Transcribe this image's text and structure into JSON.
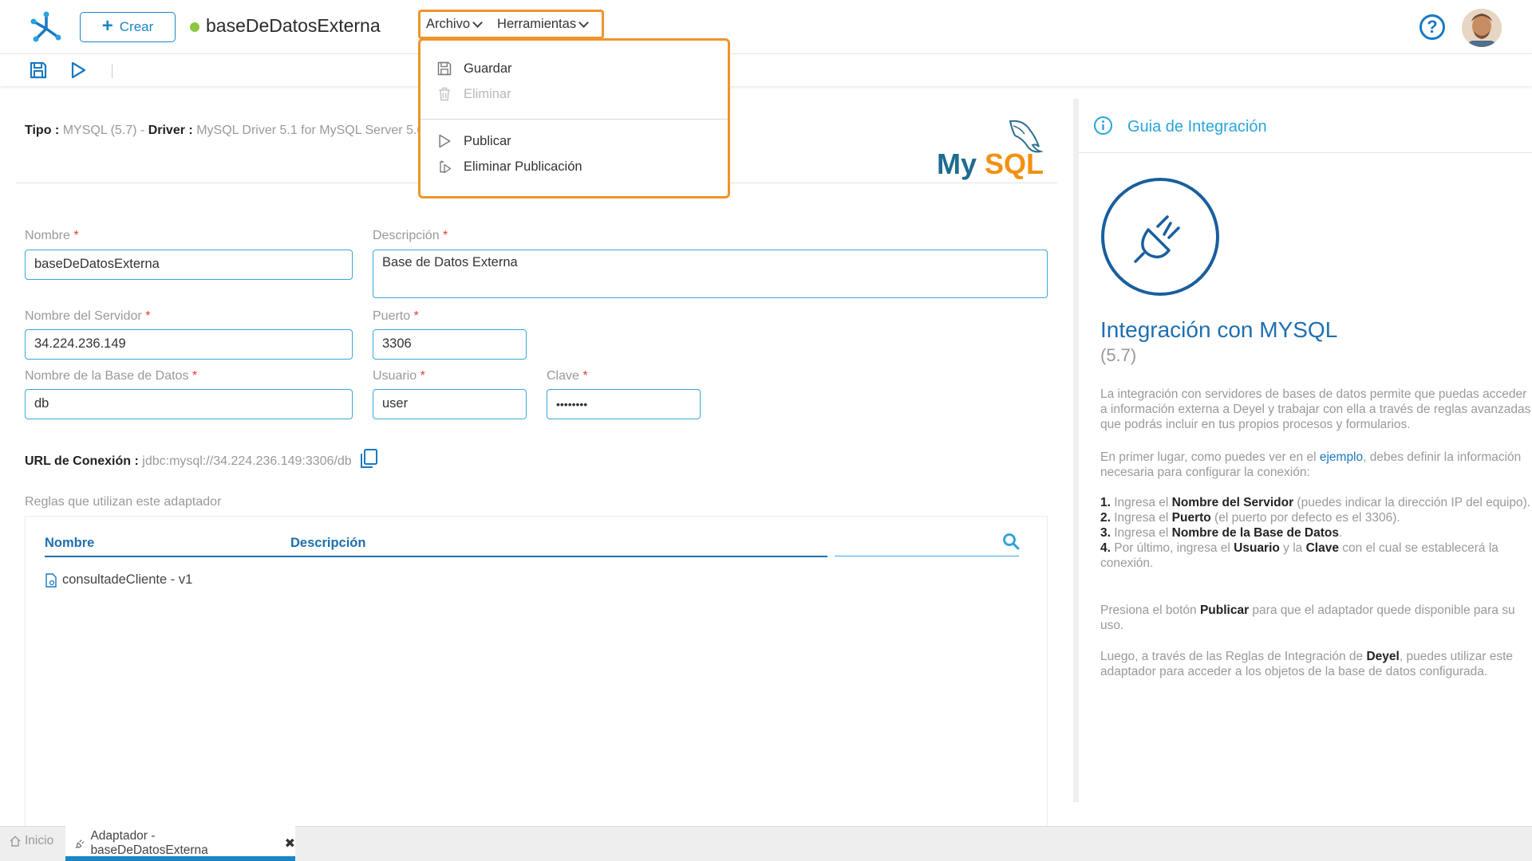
{
  "header": {
    "create_label": "Crear",
    "app_title": "baseDeDatosExterna",
    "menus": [
      {
        "label": "Archivo"
      },
      {
        "label": "Herramientas"
      }
    ],
    "help_label": "?"
  },
  "dropdown": {
    "items": [
      {
        "label": "Guardar",
        "disabled": false
      },
      {
        "label": "Eliminar",
        "disabled": true
      },
      {
        "label": "Publicar",
        "disabled": false
      },
      {
        "label": "Eliminar Publicación",
        "disabled": false
      }
    ]
  },
  "info_line": {
    "tipo_label": "Tipo :",
    "tipo_value": "MYSQL (5.7) -",
    "driver_label": "Driver :",
    "driver_value": "MySQL Driver 5.1 for MySQL Server 5.6, 5"
  },
  "mysql_logo": {
    "text_my": "My",
    "text_sql": "SQL"
  },
  "form": {
    "nombre": {
      "label": "Nombre",
      "value": "baseDeDatosExterna"
    },
    "descripcion": {
      "label": "Descripción",
      "value": "Base de Datos Externa"
    },
    "servidor": {
      "label": "Nombre del Servidor",
      "value": "34.224.236.149"
    },
    "puerto": {
      "label": "Puerto",
      "value": "3306"
    },
    "base": {
      "label": "Nombre de la Base de Datos",
      "value": "db"
    },
    "usuario": {
      "label": "Usuario",
      "value": "user"
    },
    "clave": {
      "label": "Clave",
      "value": "••••••••"
    },
    "required_mark": "*"
  },
  "url": {
    "label": "URL de Conexión :",
    "value": "jdbc:mysql://34.224.236.149:3306/db"
  },
  "rules": {
    "title": "Reglas que utilizan este adaptador",
    "col_nombre": "Nombre",
    "col_descripcion": "Descripción",
    "rows": [
      {
        "name": "consultadeCliente - v1"
      }
    ]
  },
  "guide": {
    "header_title": "Guia de Integración",
    "title": "Integración con MYSQL",
    "version": "(5.7)",
    "p1": "La integración con servidores de bases de datos permite que puedas acceder a información externa a Deyel y trabajar con ella a través de reglas avanzadas que podrás incluir en tus propios procesos y formularios.",
    "p2_a": "En primer lugar, como puedes ver en el ",
    "p2_link": "ejemplo",
    "p2_b": ", debes definir la información necesaria para configurar la conexión:",
    "steps": [
      {
        "num": "1.",
        "pre": "Ingresa el ",
        "bold": "Nombre del Servidor",
        "post": " (puedes indicar la dirección IP del equipo)."
      },
      {
        "num": "2.",
        "pre": "Ingresa el ",
        "bold": "Puerto",
        "post": " (el puerto por defecto es el 3306)."
      },
      {
        "num": "3.",
        "pre": "Ingresa el ",
        "bold": "Nombre de la Base de Datos",
        "post": "."
      },
      {
        "num": "4.",
        "pre": "Por último, ingresa el ",
        "bold": "Usuario",
        "mid": " y la ",
        "bold2": "Clave",
        "post": " con el cual se establecerá la conexión."
      }
    ],
    "p4_a": "Presiona el botón ",
    "p4_bold": "Publicar",
    "p4_b": " para que el adaptador quede disponible para su uso.",
    "p5_a": "Luego, a través de las Reglas de Integración de ",
    "p5_bold": "Deyel",
    "p5_b": ", puedes utilizar este adaptador para acceder a los objetos de la base de datos configurada."
  },
  "tabs": {
    "inicio": "Inicio",
    "adapter": "Adaptador - baseDeDatosExterna",
    "close": "✖"
  },
  "colors": {
    "accent": "#1a86c8",
    "highlight": "#f0932b",
    "field_border": "#39a7d9",
    "title_blue": "#1f6fb0",
    "guide_cyan": "#29a3dc"
  }
}
